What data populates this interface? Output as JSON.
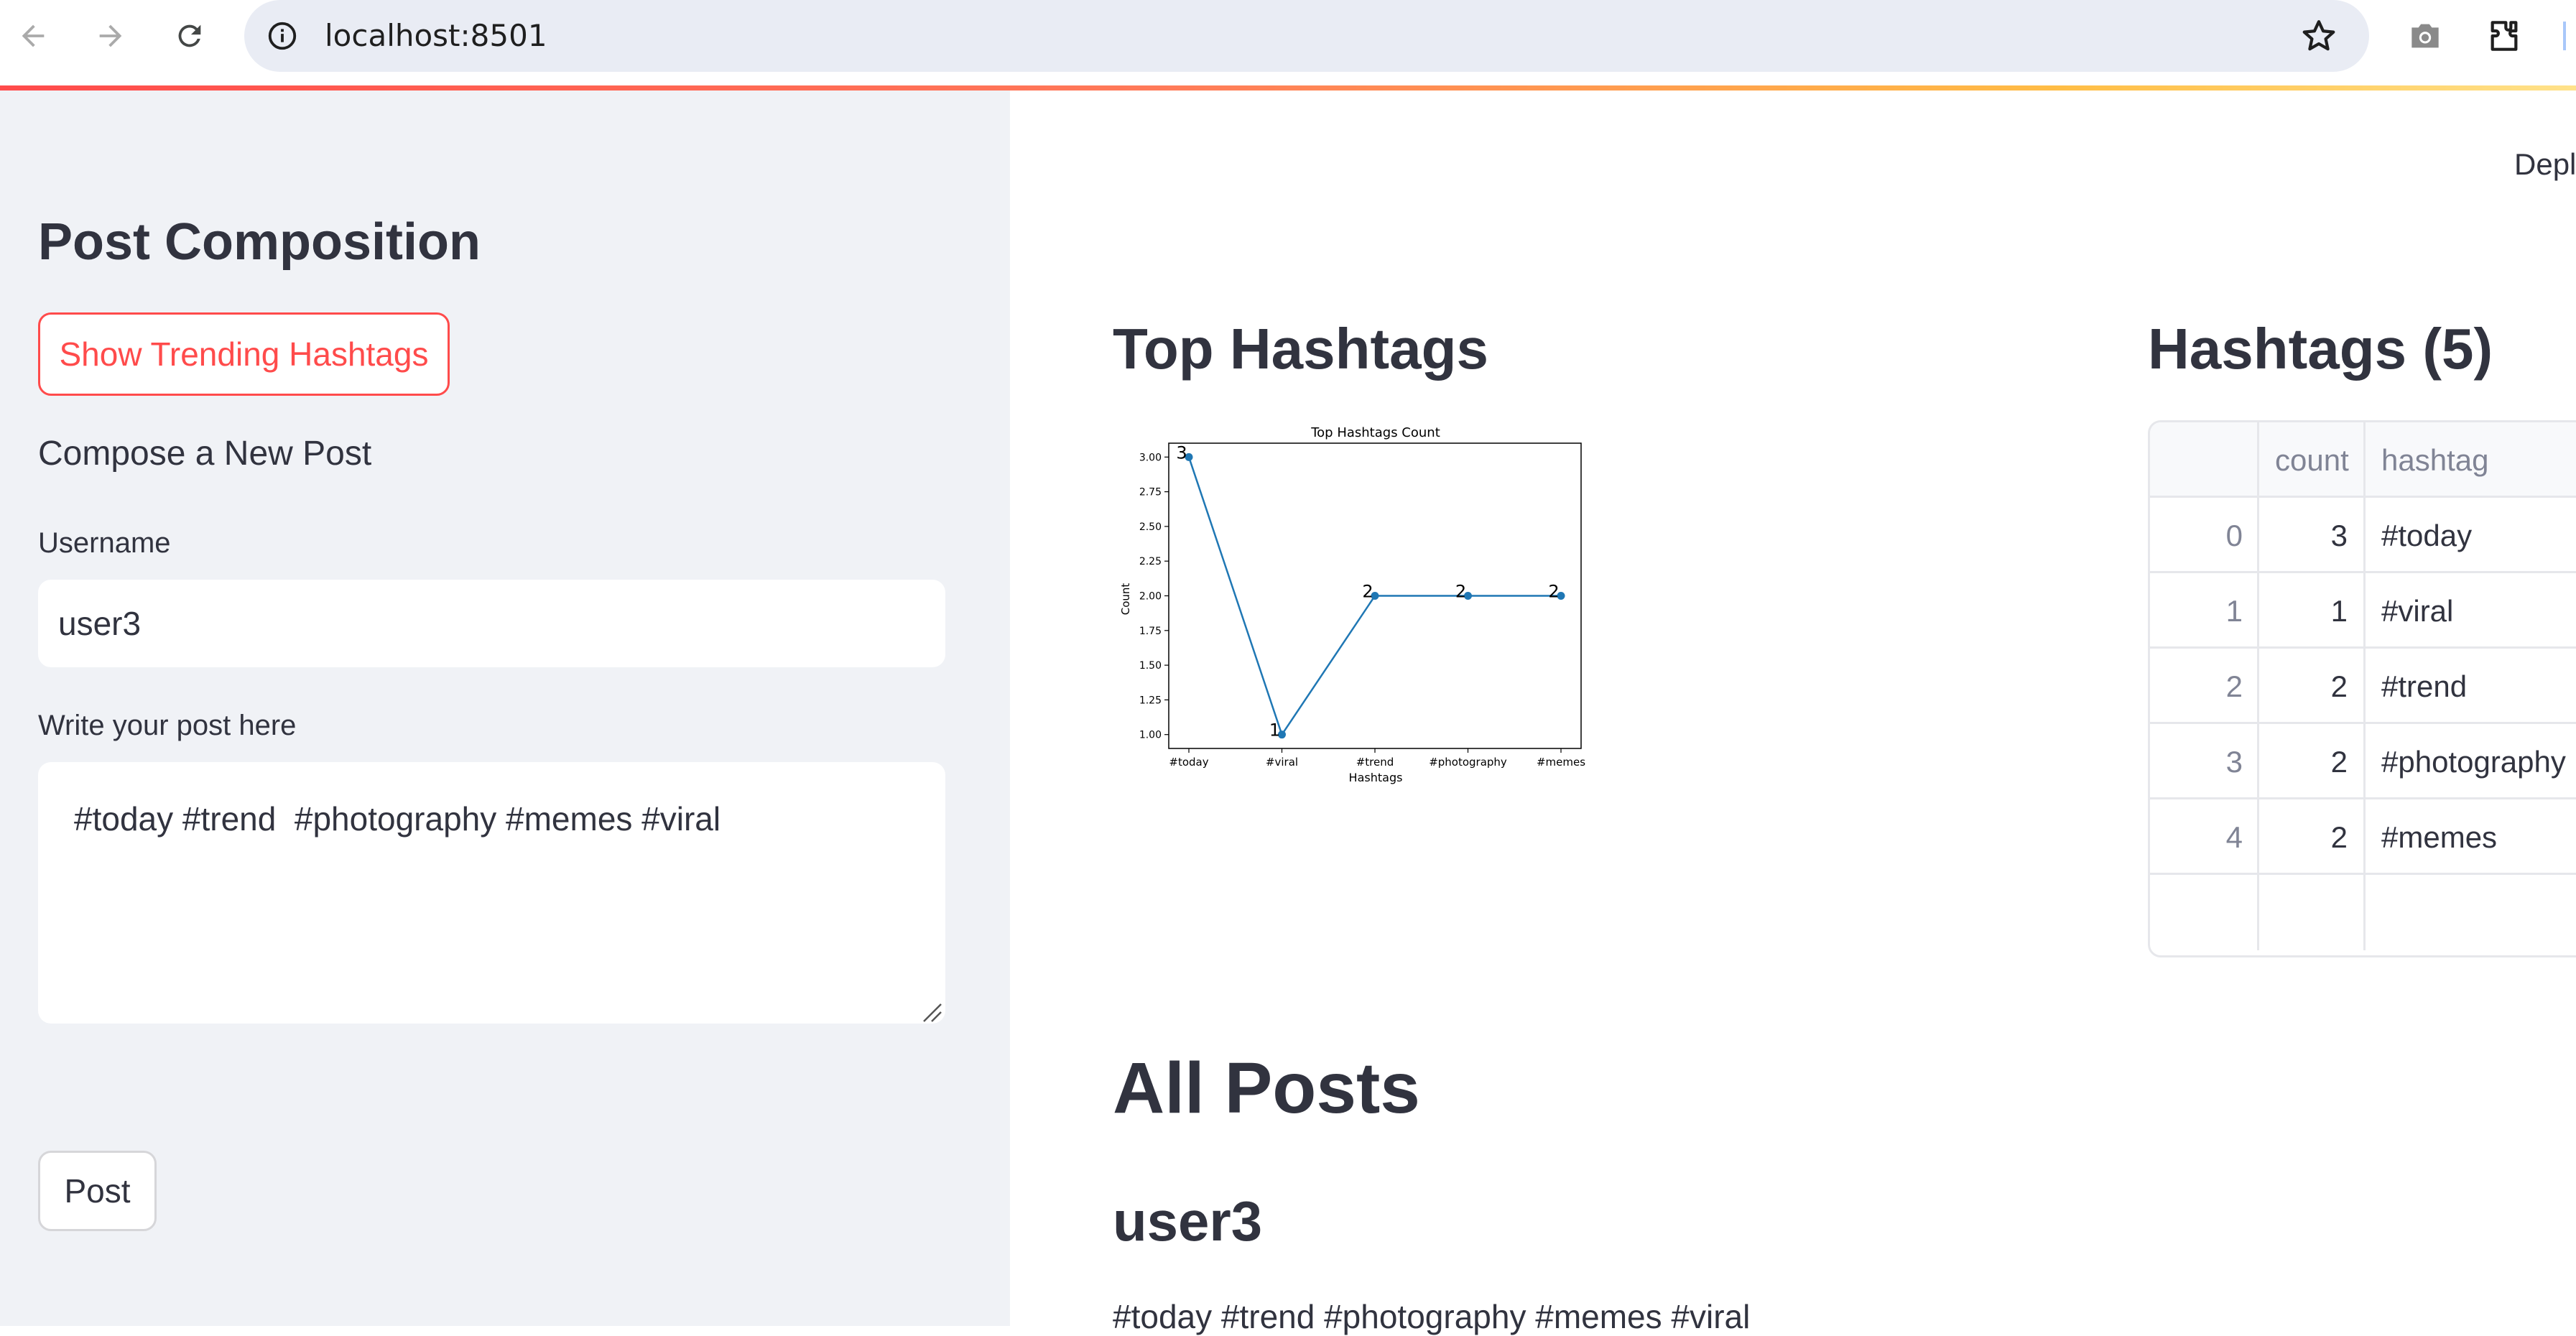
{
  "browser": {
    "url": "localhost:8501",
    "icons": [
      "back-icon",
      "forward-icon",
      "reload-icon",
      "info-icon",
      "star-icon",
      "camera-icon",
      "extensions-icon"
    ]
  },
  "app": {
    "deploy_label": "Deploy",
    "accent_color": "#ff4b4b"
  },
  "sidebar": {
    "title": "Post Composition",
    "trending_button": "Show Trending Hashtags",
    "subheading": "Compose a New Post",
    "username_label": "Username",
    "username_value": "user3",
    "post_label": "Write your post here",
    "post_value": "#today #trend  #photography #memes #viral",
    "post_button": "Post"
  },
  "main": {
    "top_hashtags_title": "Top Hashtags",
    "hashtags_table_title": "Hashtags (5)",
    "all_posts_title": "All Posts",
    "table": {
      "headers": [
        "",
        "count",
        "hashtag"
      ],
      "rows": [
        [
          "0",
          "3",
          "#today"
        ],
        [
          "1",
          "1",
          "#viral"
        ],
        [
          "2",
          "2",
          "#trend"
        ],
        [
          "3",
          "2",
          "#photography"
        ],
        [
          "4",
          "2",
          "#memes"
        ]
      ]
    },
    "posts": [
      {
        "user": "user3",
        "text": "#today #trend #photography #memes #viral"
      }
    ]
  },
  "chart_data": {
    "type": "line",
    "title": "Top Hashtags Count",
    "xlabel": "Hashtags",
    "ylabel": "Count",
    "categories": [
      "#today",
      "#viral",
      "#trend",
      "#photography",
      "#memes"
    ],
    "values": [
      3,
      1,
      2,
      2,
      2
    ],
    "data_labels": [
      "3",
      "1",
      "2",
      "2",
      "2"
    ],
    "ylim": [
      0.9,
      3.1
    ],
    "yticks": [
      "1.00",
      "1.25",
      "1.50",
      "1.75",
      "2.00",
      "2.25",
      "2.50",
      "2.75",
      "3.00"
    ],
    "line_color": "#1f77b4",
    "grid": false
  }
}
